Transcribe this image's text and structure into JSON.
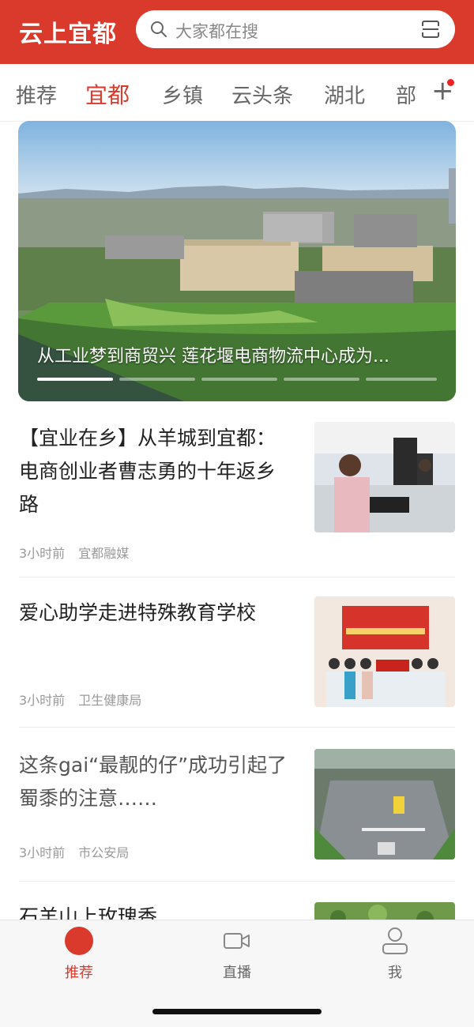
{
  "header": {
    "app_title": "云上宜都",
    "search_placeholder": "大家都在搜"
  },
  "tabs": [
    {
      "label": "推荐",
      "active": false
    },
    {
      "label": "宜都",
      "active": true
    },
    {
      "label": "乡镇",
      "active": false
    },
    {
      "label": "云头条",
      "active": false
    },
    {
      "label": "湖北",
      "active": false
    },
    {
      "label": "部",
      "active": false
    }
  ],
  "banner": {
    "caption": "从工业梦到商贸兴  莲花堰电商物流中心成为...",
    "slide_count": 5,
    "active_slide": 0
  },
  "news": [
    {
      "title": "【宜业在乡】从羊城到宜都：电商创业者曹志勇的十年返乡路",
      "time": "3小时前",
      "source": "宜都融媒"
    },
    {
      "title": "爱心助学走进特殊教育学校",
      "time": "3小时前",
      "source": "卫生健康局"
    },
    {
      "title": "这条gai“最靓的仔”成功引起了蜀黍的注意……",
      "time": "3小时前",
      "source": "市公安局"
    },
    {
      "title": "石羊山上玫瑰香",
      "time": "",
      "source": ""
    }
  ],
  "bottom_nav": [
    {
      "label": "推荐",
      "icon": "home-circle-icon",
      "active": true
    },
    {
      "label": "直播",
      "icon": "video-camera-icon",
      "active": false
    },
    {
      "label": "我",
      "icon": "user-icon",
      "active": false
    }
  ],
  "colors": {
    "brand": "#d93a2b",
    "muted": "#999999"
  }
}
